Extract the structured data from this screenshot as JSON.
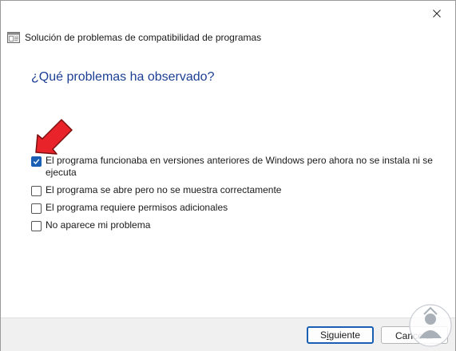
{
  "window": {
    "close_icon": "close-icon",
    "app_icon": "compatibility-troubleshooter-icon"
  },
  "header": {
    "title": "Solución de problemas de compatibilidad de programas"
  },
  "question": "¿Qué problemas ha observado?",
  "options": [
    {
      "label_line1": "El programa funcionaba en versiones anteriores de Windows pero ahora no se instala ni se",
      "label_line2": "ejecuta",
      "checked": true
    },
    {
      "label": "El programa se abre pero no se muestra correctamente",
      "checked": false
    },
    {
      "label": "El programa requiere permisos adicionales",
      "checked": false
    },
    {
      "label": "No aparece mi problema",
      "checked": false
    }
  ],
  "annotation": {
    "icon": "red-arrow-icon",
    "color": "#e8232a"
  },
  "buttons": {
    "next_prefix": "S",
    "next_underlined": "i",
    "next_suffix": "guiente",
    "cancel": "Cancelar"
  },
  "colors": {
    "accent": "#1a5fb4",
    "heading": "#1c3f94"
  }
}
